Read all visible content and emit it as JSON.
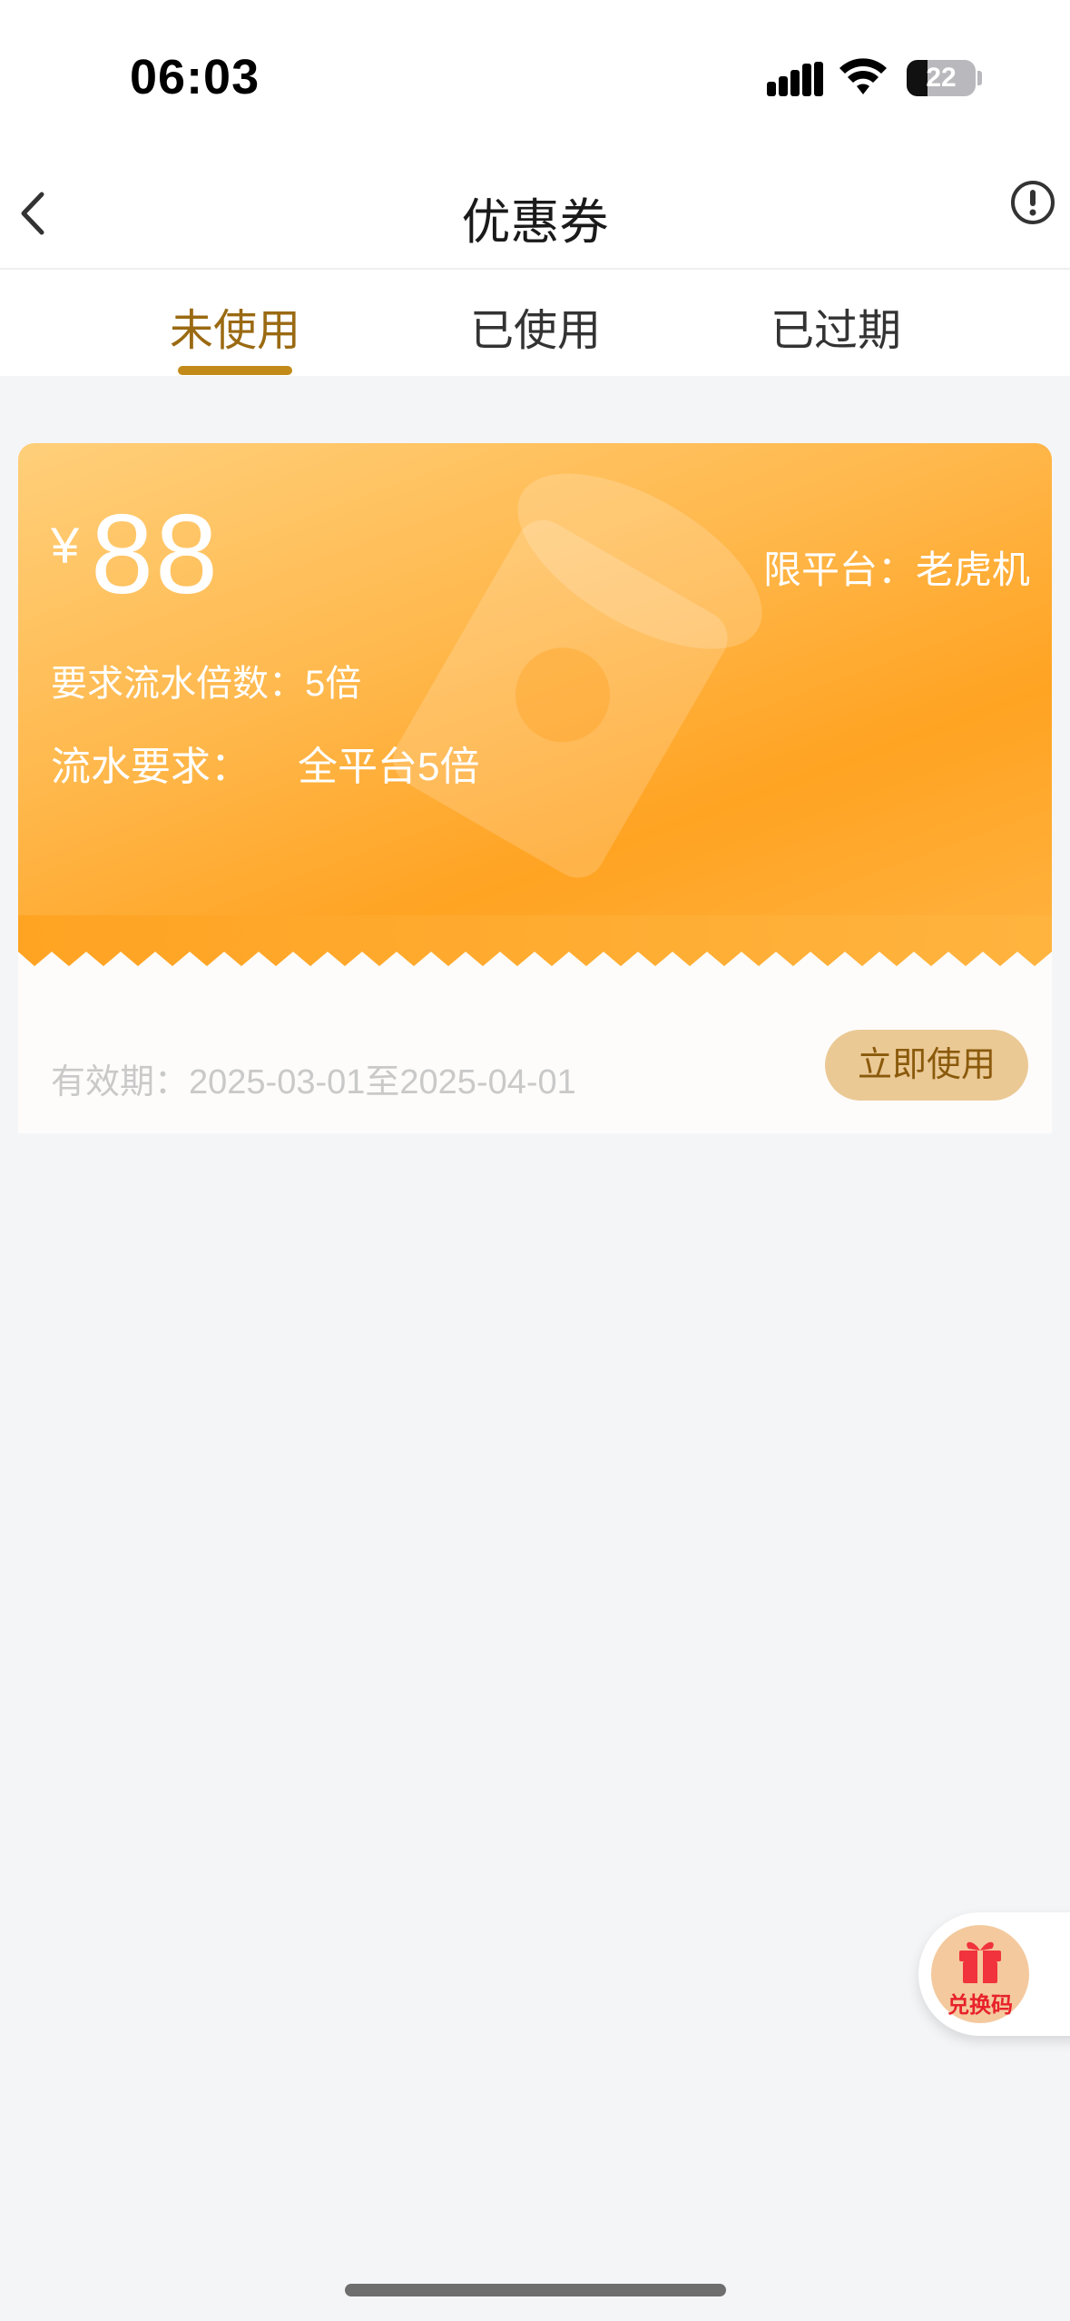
{
  "status_bar": {
    "time": "06:03",
    "battery": "22"
  },
  "nav": {
    "title": "优惠券"
  },
  "tabs": [
    {
      "label": "未使用",
      "active": true
    },
    {
      "label": "已使用",
      "active": false
    },
    {
      "label": "已过期",
      "active": false
    }
  ],
  "coupon": {
    "currency_symbol": "¥",
    "amount": "88",
    "platform": "限平台：老虎机",
    "multiplier": "要求流水倍数：5倍",
    "flow_label": "流水要求：",
    "flow_value": "全平台5倍",
    "validity": "有效期：2025-03-01至2025-04-01",
    "use_button": "立即使用"
  },
  "redeem": {
    "label": "兑换码"
  },
  "colors": {
    "accent": "#c28a19",
    "active_tab_text": "#9a6a12",
    "card_orange": "#ffa322",
    "use_button_bg": "#ebc995",
    "redeem_red": "#e8212b"
  }
}
